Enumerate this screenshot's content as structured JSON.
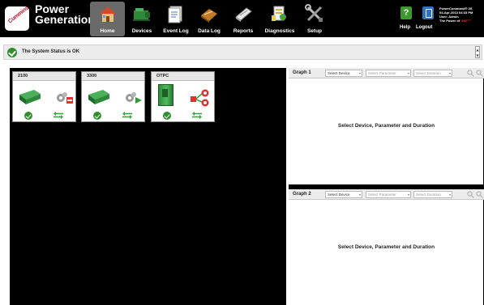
{
  "brand": {
    "line1": "Power",
    "line2": "Generation",
    "badge": "Cummins"
  },
  "nav": [
    {
      "label": "Home",
      "icon": "home-icon",
      "active": true
    },
    {
      "label": "Devices",
      "icon": "devices-icon",
      "active": false
    },
    {
      "label": "Event Log",
      "icon": "event-log-icon",
      "active": false
    },
    {
      "label": "Data Log",
      "icon": "data-log-icon",
      "active": false
    },
    {
      "label": "Reports",
      "icon": "reports-icon",
      "active": false
    },
    {
      "label": "Diagnostics",
      "icon": "diagnostics-icon",
      "active": false
    },
    {
      "label": "Setup",
      "icon": "setup-icon",
      "active": false
    }
  ],
  "header_actions": {
    "help_label": "Help",
    "help_glyph": "?",
    "logout_label": "Logout"
  },
  "user_info": {
    "product": "PowerCommand® 3S",
    "datetime": "04-Apr-2013 04:33 PM",
    "user": "User: Admin",
    "tagline_prefix": "The Power of ",
    "tagline_emphasis": "ONE™"
  },
  "status": {
    "text": "The System Status is OK",
    "scroll_up": "▲",
    "scroll_down": "▼"
  },
  "devices": [
    {
      "name": "2100",
      "kind": "genset",
      "state_icon": "stopped-icon"
    },
    {
      "name": "3300",
      "kind": "genset",
      "state_icon": "running-icon"
    },
    {
      "name": "OTPC",
      "kind": "transfer-switch",
      "state_icon": "transfer-icon"
    }
  ],
  "graphs": [
    {
      "title": "Graph 1",
      "device_select": "Select Device",
      "parameter_select": "Select Parameter",
      "duration_select": "Select Duration",
      "message": "Select Device, Parameter and Duration"
    },
    {
      "title": "Graph 2",
      "device_select": "Select Device",
      "parameter_select": "Select Parameter",
      "duration_select": "Select Duration",
      "message": "Select Device, Parameter and Duration"
    }
  ],
  "colors": {
    "header_bg": "#000000",
    "ok_green": "#2f8f2f",
    "alarm_red": "#e03030",
    "active_tab": "#6a6a6a"
  }
}
